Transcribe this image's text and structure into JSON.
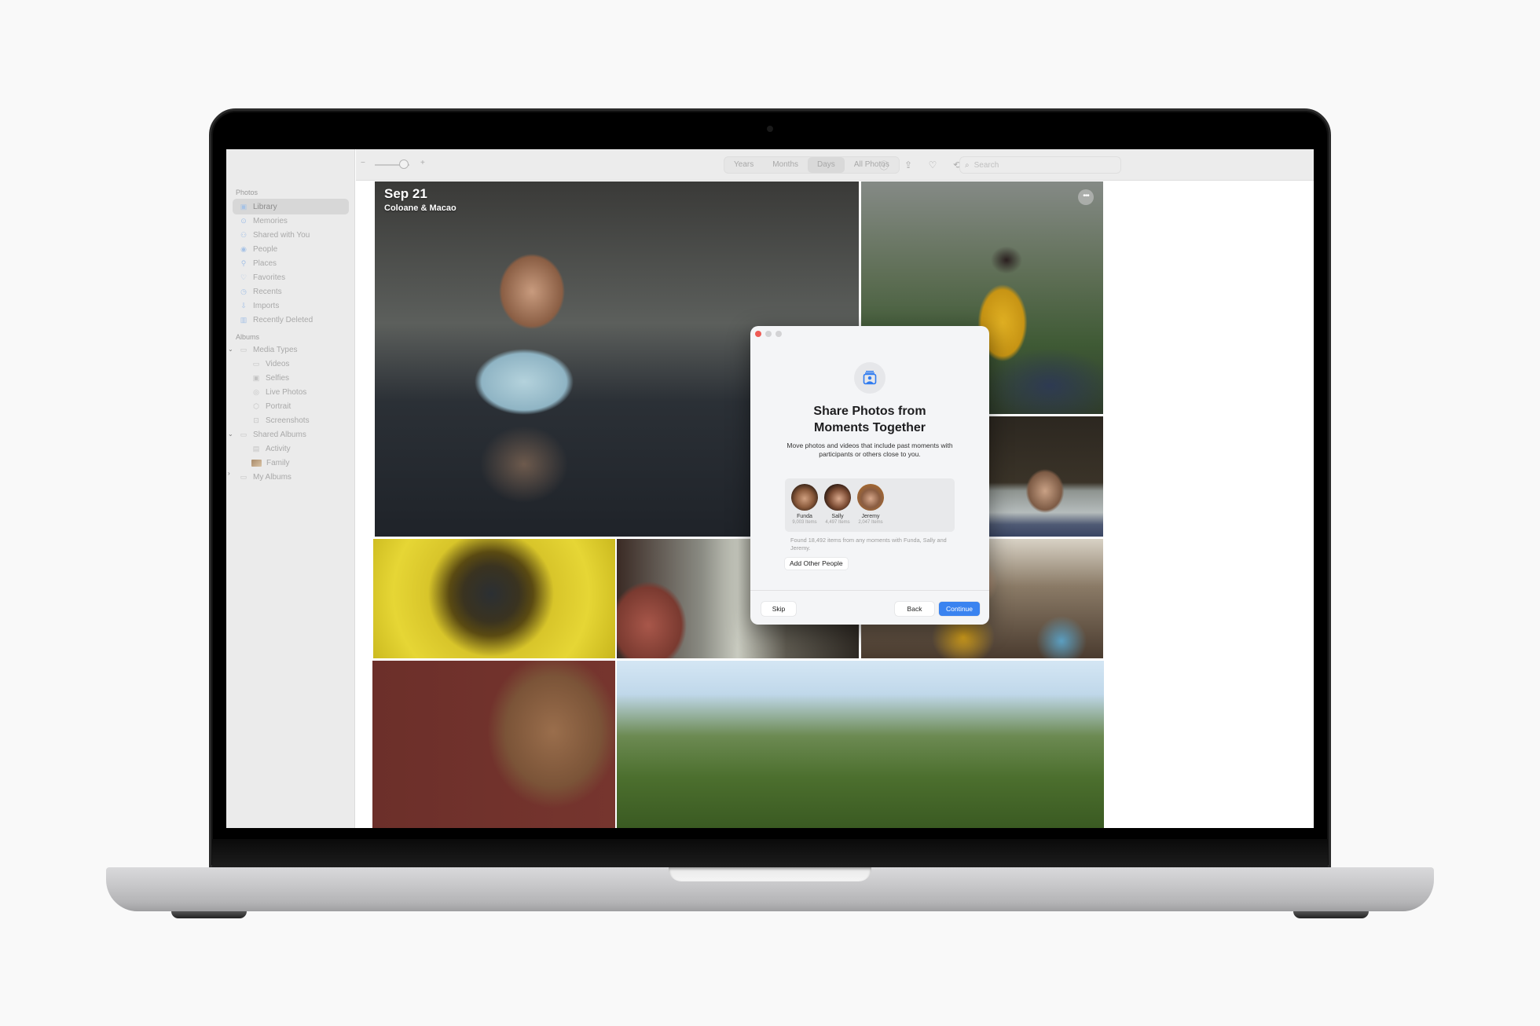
{
  "app": {
    "name": "Photos",
    "sidebar": {
      "photos_section": "Photos",
      "photos_items": [
        {
          "label": "Library",
          "icon": "library-icon",
          "selected": true
        },
        {
          "label": "Memories",
          "icon": "memories-icon"
        },
        {
          "label": "Shared with You",
          "icon": "shared-with-you-icon"
        },
        {
          "label": "People",
          "icon": "people-icon"
        },
        {
          "label": "Places",
          "icon": "places-icon"
        },
        {
          "label": "Favorites",
          "icon": "heart-icon"
        },
        {
          "label": "Recents",
          "icon": "clock-icon"
        },
        {
          "label": "Imports",
          "icon": "import-icon"
        },
        {
          "label": "Recently Deleted",
          "icon": "trash-icon"
        }
      ],
      "albums_section": "Albums",
      "albums_items": [
        {
          "label": "Media Types",
          "icon": "folder-icon",
          "disclosure": "expanded"
        },
        {
          "label": "Videos",
          "icon": "video-icon",
          "level": 2
        },
        {
          "label": "Selfies",
          "icon": "selfie-icon",
          "level": 2
        },
        {
          "label": "Live Photos",
          "icon": "live-photo-icon",
          "level": 2
        },
        {
          "label": "Portrait",
          "icon": "portrait-icon",
          "level": 2
        },
        {
          "label": "Screenshots",
          "icon": "screenshot-icon",
          "level": 2
        },
        {
          "label": "Shared Albums",
          "icon": "shared-folder-icon",
          "disclosure": "expanded"
        },
        {
          "label": "Activity",
          "icon": "activity-icon",
          "level": 2
        },
        {
          "label": "Family",
          "icon": "family-album-thumb",
          "level": 2
        },
        {
          "label": "My Albums",
          "icon": "folder-icon",
          "disclosure": "collapsed"
        }
      ]
    },
    "toolbar": {
      "zoom_minus": "−",
      "zoom_plus": "+",
      "zoom_level": 0.85,
      "view_tabs": [
        {
          "label": "Years"
        },
        {
          "label": "Months"
        },
        {
          "label": "Days",
          "selected": true
        },
        {
          "label": "All Photos"
        }
      ],
      "icons": [
        "info-icon",
        "share-icon",
        "heart-icon",
        "rotate-icon"
      ],
      "search_placeholder": "Search"
    },
    "library": {
      "date_title": "Sep 21",
      "location": "Coloane & Macao",
      "more_glyph": "•••"
    },
    "dialog": {
      "title_line1": "Share Photos from",
      "title_line2": "Moments Together",
      "description": "Move photos and videos that include past moments with participants or others close to you.",
      "people": [
        {
          "name": "Funda",
          "count": "9,003 Items"
        },
        {
          "name": "Sally",
          "count": "4,497 Items"
        },
        {
          "name": "Jeremy",
          "count": "2,047 Items"
        }
      ],
      "found_text": "Found 18,492 items from any moments with Funda, Sally and Jeremy.",
      "add_people_label": "Add Other People",
      "skip_label": "Skip",
      "back_label": "Back",
      "continue_label": "Continue",
      "accent_color": "#3a83f0"
    }
  }
}
